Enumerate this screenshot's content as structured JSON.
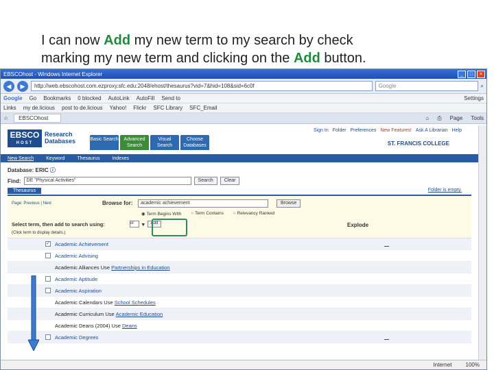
{
  "caption": {
    "line1_pre": "I can now ",
    "line1_hl": "Add",
    "line1_post": " my new term to my search by check",
    "line2_pre": "marking my new term and clicking on the ",
    "line2_hl": "Add",
    "line2_post": " button."
  },
  "browser": {
    "title": "EBSCOhost - Windows Internet Explorer",
    "url": "http://web.ebscohost.com.ezproxy.sfc.edu:2048/ehost/thesaurus?vid=7&hid=108&sid=6c0f",
    "search_placeholder": "Google",
    "toolbar_items": [
      "Google",
      "Go",
      "Bookmarks",
      "0 blocked",
      "AutoLink",
      "AutoFill",
      "Send to",
      "Settings"
    ],
    "links_items": [
      "Links",
      "my de.licious",
      "post to de.licious",
      "Yahoo!",
      "Flickr",
      "SFC Library",
      "SFC_Email"
    ],
    "tab_label": "EBSCOhost",
    "tools": [
      "Page",
      "Tools"
    ],
    "status_zone": "Internet",
    "zoom": "100%"
  },
  "ebsco": {
    "logo_main": "EBSCO",
    "logo_sub": "HOST",
    "product_line1": "Research",
    "product_line2": "Databases",
    "tabs": [
      "Basic Search",
      "Advanced Search",
      "Visual Search",
      "Choose Databases"
    ],
    "top_links": [
      "Sign In",
      "Folder",
      "Preferences",
      "New Features!",
      "Ask A Librarian",
      "Help"
    ],
    "college": "ST. FRANCIS COLLEGE",
    "bluebar": [
      "New Search",
      "Keyword",
      "Thesaurus",
      "Indexes"
    ],
    "database_label": "Database:",
    "database_value": "ERIC",
    "find_label": "Find:",
    "find_value": "DE \"Physical Activities\"",
    "search_btn": "Search",
    "clear_btn": "Clear",
    "panel_tab": "Thesaurus",
    "folder_text": "Folder is empty.",
    "prev_next": "Page: Previous | Next",
    "browse_label": "Browse for:",
    "browse_value": "academic achievement",
    "browse_btn": "Browse",
    "radios": [
      "Term Begins With",
      "Term Contains",
      "Relevancy Ranked"
    ],
    "select_label": "Select term, then add to search using:",
    "or_value": "or",
    "add_btn": "Add",
    "explode": "Explode",
    "click_hint": "(Click term to display details.)",
    "terms": [
      {
        "kind": "check",
        "checked": true,
        "label": "Academic Achievement",
        "explode": true
      },
      {
        "kind": "check",
        "checked": false,
        "label": "Academic Advising",
        "explode": false
      },
      {
        "kind": "use",
        "label": "Academic Alliances Use",
        "link": "Partnerships in Education"
      },
      {
        "kind": "check",
        "checked": false,
        "label": "Academic Aptitude",
        "explode": false
      },
      {
        "kind": "check",
        "checked": false,
        "label": "Academic Aspiration",
        "explode": false
      },
      {
        "kind": "use",
        "label": "Academic Calendars Use",
        "link": "School Schedules"
      },
      {
        "kind": "use",
        "label": "Academic Curriculum Use",
        "link": "Academic Education"
      },
      {
        "kind": "use",
        "label": "Academic Deans (2004) Use",
        "link": "Deans"
      },
      {
        "kind": "check",
        "checked": false,
        "label": "Academic Degrees",
        "explode": true
      }
    ]
  }
}
